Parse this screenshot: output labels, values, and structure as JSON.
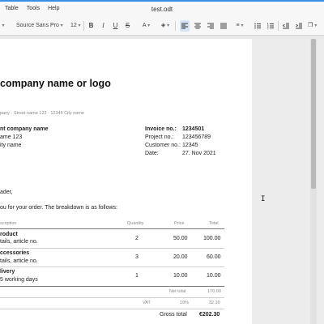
{
  "menu": [
    "Table",
    "Tools",
    "Help"
  ],
  "document_title": "test.odt",
  "toolbar": {
    "font_family": "Source Sans Pro",
    "font_size": "12",
    "bold": "B",
    "italic": "I",
    "underline": "U",
    "strikethrough": "S",
    "font_color": "A",
    "highlight_color": "A"
  },
  "invoice": {
    "heading": "company name or logo",
    "sender_line": "pany · Street name 123 · 12345 City name",
    "recipient": [
      "nt company name",
      "ame 123",
      "ity name"
    ],
    "meta": [
      {
        "label": "Invoice no.:",
        "value": "1234501"
      },
      {
        "label": "Project no.:",
        "value": "123456789"
      },
      {
        "label": "Customer no.:",
        "value": "12345"
      },
      {
        "label": "Date:",
        "value": "27. Nov 2021"
      }
    ],
    "greeting": "ader,",
    "intro": "ou for your order. The breakdown is as follows:",
    "table_headers": {
      "description": "scription",
      "quantity": "Quantity",
      "price": "Price",
      "total": "Total"
    },
    "items": [
      {
        "title": "roduct",
        "detail": "tails, article no.",
        "qty": "2",
        "price": "50.00",
        "total": "100.00"
      },
      {
        "title": "ccessories",
        "detail": "tails, article no.",
        "qty": "3",
        "price": "20.00",
        "total": "60.00"
      },
      {
        "title": "livery",
        "detail": "5 working days",
        "qty": "1",
        "price": "10.00",
        "total": "10.00"
      }
    ],
    "net_label": "Net total",
    "net_value": "170.00",
    "vat_label": "VAT",
    "vat_rate": "19%",
    "vat_value": "32.30",
    "gross_label": "Gross total",
    "gross_value": "€202.30"
  }
}
